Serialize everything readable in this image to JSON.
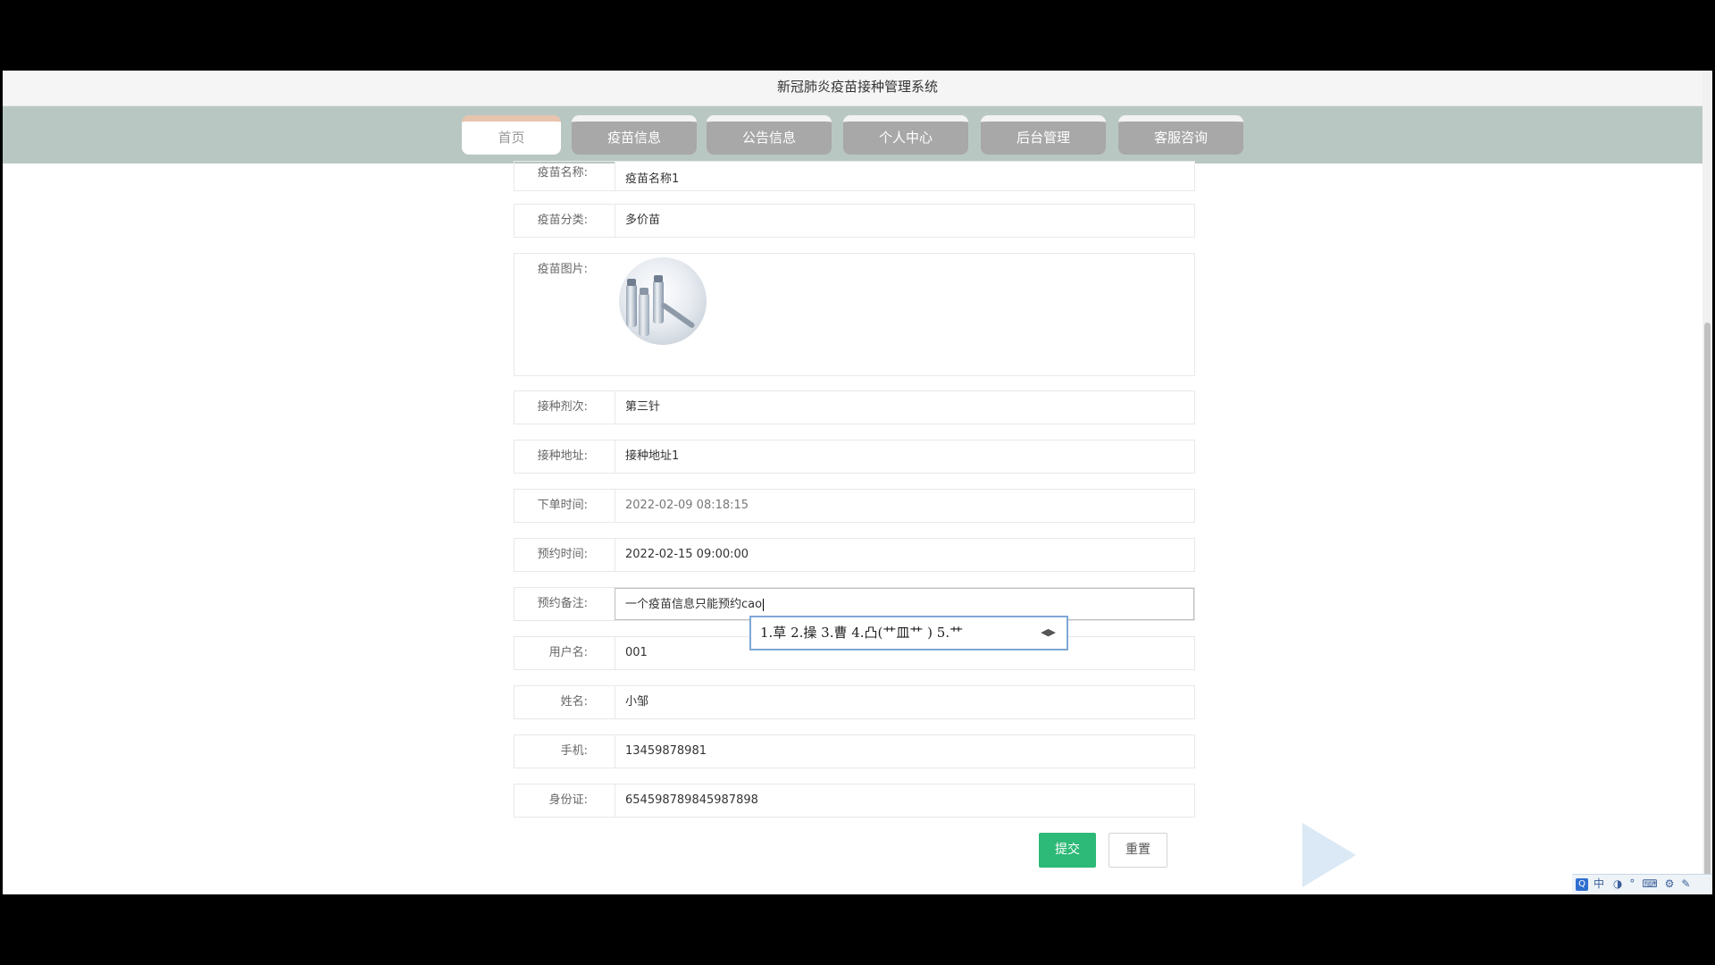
{
  "app": {
    "title": "新冠肺炎疫苗接种管理系统"
  },
  "nav": {
    "tabs": [
      {
        "label": "首页"
      },
      {
        "label": "疫苗信息"
      },
      {
        "label": "公告信息"
      },
      {
        "label": "个人中心"
      },
      {
        "label": "后台管理"
      },
      {
        "label": "客服咨询"
      }
    ],
    "active_tab": "首页"
  },
  "form": {
    "vaccine_name": {
      "label": "疫苗名称:",
      "value": "疫苗名称1"
    },
    "vaccine_category": {
      "label": "疫苗分类:",
      "value": "多价苗"
    },
    "vaccine_image": {
      "label": "疫苗图片:"
    },
    "dose": {
      "label": "接种剂次:",
      "value": "第三针"
    },
    "address": {
      "label": "接种地址:",
      "value": "接种地址1"
    },
    "order_time": {
      "label": "下单时间:",
      "value": "2022-02-09 08:18:15"
    },
    "appointment_time": {
      "label": "预约时间:",
      "value": "2022-02-15 09:00:00"
    },
    "remark": {
      "label": "预约备注:",
      "value": "一个疫苗信息只能预约cao"
    },
    "username": {
      "label": "用户名:",
      "value": "001"
    },
    "name": {
      "label": "姓名:",
      "value": "小邹"
    },
    "phone": {
      "label": "手机:",
      "value": "13459878981"
    },
    "id_card": {
      "label": "身份证:",
      "value": "654598789845987898"
    }
  },
  "ime": {
    "candidates": "1.草  2.操  3.曹  4.凸(艹皿艹 )  5.艹"
  },
  "buttons": {
    "submit": "提交",
    "reset": "重置"
  },
  "taskbar": {
    "ime_mode": "中"
  },
  "colors": {
    "nav_bg": "#b9c7c2",
    "tab_inactive": "#a8a8a8",
    "submit": "#2db977"
  }
}
